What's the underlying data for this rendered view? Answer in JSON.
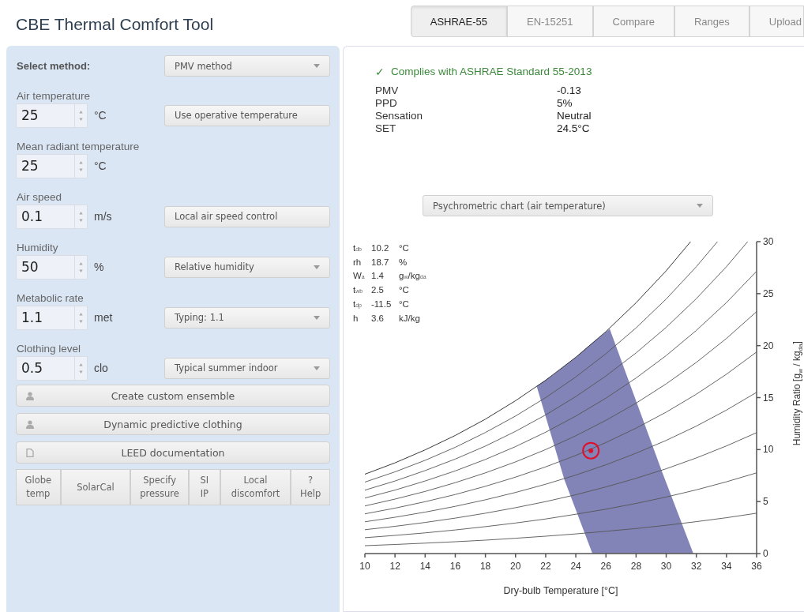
{
  "header": {
    "title": "CBE Thermal Comfort Tool"
  },
  "tabs": [
    {
      "label": "ASHRAE-55",
      "selected": true
    },
    {
      "label": "EN-15251",
      "selected": false
    },
    {
      "label": "Compare",
      "selected": false
    },
    {
      "label": "Ranges",
      "selected": false
    },
    {
      "label": "Upload",
      "selected": false
    }
  ],
  "inputs": {
    "method": {
      "label": "Select method:",
      "value": "PMV method"
    },
    "fields": [
      {
        "label": "Air temperature",
        "value": "25",
        "unit": "°C",
        "control": {
          "kind": "button",
          "text": "Use operative temperature"
        }
      },
      {
        "label": "Mean radiant temperature",
        "value": "25",
        "unit": "°C"
      },
      {
        "label": "Air speed",
        "value": "0.1",
        "unit": "m/s",
        "control": {
          "kind": "button",
          "text": "Local air speed control"
        }
      },
      {
        "label": "Humidity",
        "value": "50",
        "unit": "%",
        "control": {
          "kind": "dropdown",
          "text": "Relative humidity"
        }
      },
      {
        "label": "Metabolic rate",
        "value": "1.1",
        "unit": "met",
        "control": {
          "kind": "dropdown",
          "text": "Typing: 1.1"
        }
      },
      {
        "label": "Clothing level",
        "value": "0.5",
        "unit": "clo",
        "control": {
          "kind": "dropdown",
          "text": "Typical summer indoor"
        }
      }
    ],
    "actions": [
      {
        "kind": "person",
        "label": "Create custom ensemble"
      },
      {
        "kind": "person",
        "label": "Dynamic predictive clothing"
      },
      {
        "kind": "document",
        "label": "LEED documentation"
      }
    ],
    "tools": [
      {
        "lines": [
          "Globe",
          "temp"
        ]
      },
      {
        "lines": [
          "SolarCal"
        ]
      },
      {
        "lines": [
          "Specify",
          "pressure"
        ]
      },
      {
        "lines": [
          "SI",
          "IP"
        ]
      },
      {
        "lines": [
          "Local",
          "discomfort"
        ]
      },
      {
        "lines": [
          "?",
          "Help"
        ]
      }
    ]
  },
  "results": {
    "compliance": {
      "mark": "✓",
      "text": "Complies with ASHRAE Standard 55-2013"
    },
    "rows": [
      {
        "label": "PMV",
        "value": "-0.13"
      },
      {
        "label": "PPD",
        "value": "5%"
      },
      {
        "label": "Sensation",
        "value": "Neutral"
      },
      {
        "label": "SET",
        "value": "24.5°C"
      }
    ]
  },
  "chart_selector": {
    "value": "Psychrometric chart (air temperature)"
  },
  "readout": [
    {
      "label": "t$_{db}$",
      "value": "10.2",
      "unit": "°C"
    },
    {
      "label": "rh",
      "value": "18.7",
      "unit": "%"
    },
    {
      "label": "W$_{a}$",
      "value": "1.4",
      "unit": "g$_{w}$/kg$_{da}$"
    },
    {
      "label": "t$_{wb}$",
      "value": "2.5",
      "unit": "°C"
    },
    {
      "label": "t$_{dp}$",
      "value": "-11.5",
      "unit": "°C"
    },
    {
      "label": "h",
      "value": "3.6",
      "unit": "kJ/kg"
    }
  ],
  "chart": {
    "chart_data": {
      "type": "scatter",
      "xlabel": "Dry-bulb Temperature [°C]",
      "ylabel": "Humidity Ratio [g$_{w}$ / kg$_{da}$]",
      "xlim": [
        10,
        36
      ],
      "ylim": [
        0,
        30
      ],
      "xticks": [
        10,
        12,
        14,
        16,
        18,
        20,
        22,
        24,
        26,
        28,
        30,
        32,
        34,
        36
      ],
      "x": [
        10,
        12,
        14,
        16,
        18,
        20,
        22,
        24,
        26,
        28,
        30,
        32,
        34,
        36
      ],
      "yticks": [
        0,
        5,
        10,
        15,
        20,
        25,
        30
      ],
      "series": [
        {
          "type": "area",
          "color": "#7b7db3",
          "x": [
            21.4,
            22.5,
            24,
            25.2,
            26.25,
            29.74,
            31.8,
            25.1,
            23.24
          ],
          "values": [
            16.1,
            17.2,
            18.9,
            20.4,
            21.6,
            7.8,
            0,
            0,
            7.1
          ]
        },
        {
          "type": "line",
          "color": "#555555",
          "values": [
            0.76,
            0.87,
            1.0,
            1.14,
            1.29,
            1.47,
            1.67,
            1.89,
            2.14,
            2.41,
            2.72,
            3.07,
            3.45,
            3.88
          ]
        },
        {
          "type": "line",
          "color": "#555555",
          "values": [
            1.53,
            1.75,
            1.99,
            2.27,
            2.59,
            2.94,
            3.33,
            3.78,
            4.27,
            4.82,
            5.44,
            6.13,
            6.9,
            7.76
          ]
        },
        {
          "type": "line",
          "color": "#555555",
          "values": [
            2.29,
            2.62,
            2.99,
            3.41,
            3.88,
            4.41,
            5.0,
            5.66,
            6.41,
            7.24,
            8.16,
            9.2,
            10.35,
            11.63
          ]
        },
        {
          "type": "line",
          "color": "#555555",
          "values": [
            3.05,
            3.49,
            3.99,
            4.54,
            5.17,
            5.88,
            6.67,
            7.55,
            8.54,
            9.65,
            10.88,
            12.26,
            13.8,
            15.51
          ]
        },
        {
          "type": "line",
          "color": "#555555",
          "values": [
            3.82,
            4.37,
            4.99,
            5.68,
            6.47,
            7.35,
            8.34,
            9.44,
            10.68,
            12.06,
            13.6,
            15.33,
            17.25,
            19.39
          ]
        },
        {
          "type": "line",
          "color": "#555555",
          "values": [
            4.58,
            5.24,
            5.98,
            6.82,
            7.76,
            8.82,
            10.0,
            11.33,
            12.81,
            14.47,
            16.32,
            18.39,
            20.69,
            23.27
          ]
        },
        {
          "type": "line",
          "color": "#555555",
          "values": [
            5.34,
            6.11,
            6.98,
            7.95,
            9.05,
            10.29,
            11.67,
            13.22,
            14.95,
            16.88,
            19.04,
            21.46,
            24.14,
            27.15
          ]
        },
        {
          "type": "line",
          "color": "#555555",
          "x": [
            10,
            12,
            14,
            16,
            18,
            20,
            22,
            24,
            26,
            28,
            30,
            32,
            34,
            35.41
          ],
          "values": [
            6.1,
            6.98,
            7.98,
            9.09,
            10.34,
            11.76,
            13.34,
            15.1,
            17.08,
            19.3,
            21.76,
            24.52,
            27.59,
            30
          ]
        },
        {
          "type": "line",
          "color": "#555555",
          "x": [
            10,
            12,
            14,
            16,
            18,
            20,
            22,
            24,
            26,
            28,
            30,
            32,
            33.4
          ],
          "values": [
            6.87,
            7.86,
            8.97,
            10.22,
            11.64,
            13.23,
            15.0,
            16.99,
            19.22,
            21.71,
            24.48,
            27.59,
            30
          ]
        },
        {
          "type": "line",
          "color": "#222222",
          "x": [
            10,
            12,
            14,
            16,
            18,
            20,
            22,
            24,
            26,
            28,
            30,
            31.62
          ],
          "values": [
            7.63,
            8.73,
            9.97,
            11.36,
            12.93,
            14.7,
            16.67,
            18.88,
            21.35,
            24.12,
            27.2,
            30
          ]
        },
        {
          "type": "scatter",
          "color": "#e0102a",
          "x": [
            25
          ],
          "values": [
            9.9
          ]
        }
      ]
    }
  }
}
